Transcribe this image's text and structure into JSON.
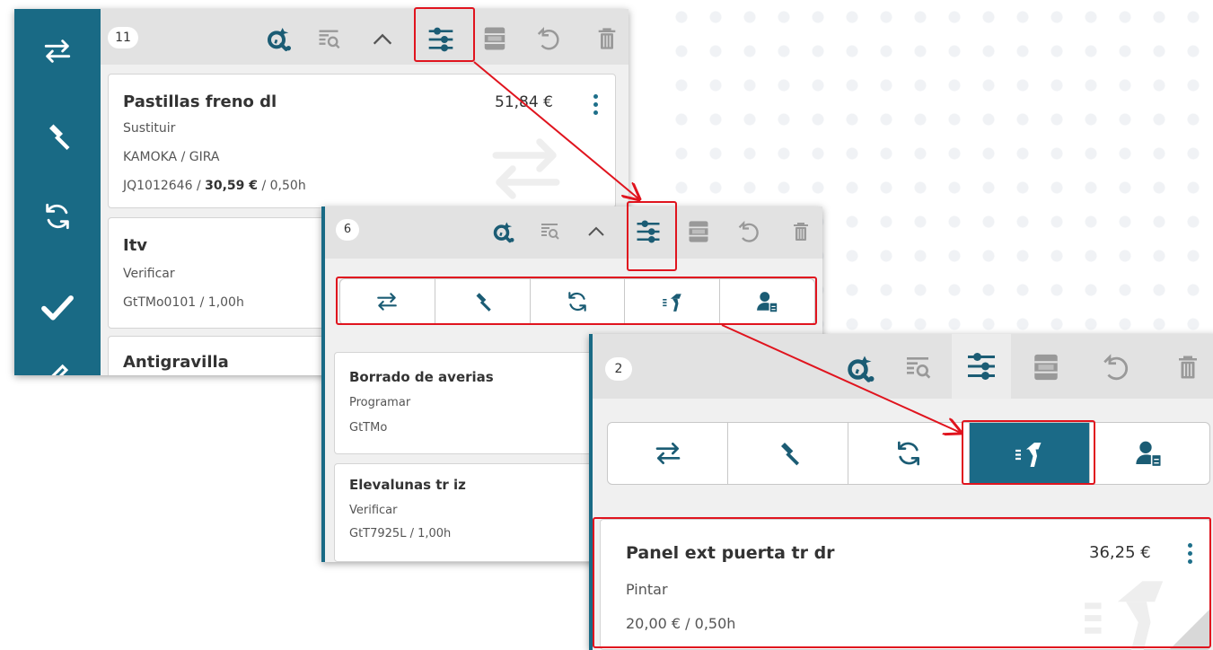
{
  "panel1": {
    "count": "11",
    "cards": [
      {
        "title": "Pastillas freno dl",
        "action": "Sustituir",
        "brand": "KAMOKA / GIRA",
        "ref": "JQ1012646 / ",
        "ref_price": "30,59 €",
        "ref_time": " / 0,50h",
        "price": "51,84 €"
      },
      {
        "title": "Itv",
        "action": "Verificar",
        "ref": "GtTMo0101 / 1,00h"
      },
      {
        "title": "Antigravilla"
      }
    ]
  },
  "panel2": {
    "count": "6",
    "cards": [
      {
        "title": "Borrado de averias",
        "action": "Programar",
        "ref": "GtTMo"
      },
      {
        "title": "Elevalunas tr iz",
        "action": "Verificar",
        "ref": "GtT7925L / 1,00h"
      }
    ]
  },
  "panel3": {
    "count": "2",
    "card": {
      "title": "Panel ext puerta tr dr",
      "action": "Pintar",
      "ref": "20,00 € / 0,50h",
      "price": "36,25 €"
    }
  },
  "icons": {
    "sidebar": [
      "swap-arrows-icon",
      "hammer-icon",
      "refresh-icon",
      "check-icon",
      "edit-icon"
    ],
    "toolbar": [
      "inspect-icon",
      "search-list-icon",
      "chevron-up-icon",
      "filter-sliders-icon",
      "storage-icon",
      "undo-icon",
      "trash-icon"
    ],
    "filters": [
      "swap-arrows-icon",
      "hammer-icon",
      "refresh-icon",
      "spray-gun-icon",
      "worker-clipboard-icon"
    ]
  },
  "colors": {
    "accent": "#196a85",
    "highlight": "#e0141e",
    "toolbar": "#e2e2e2"
  }
}
